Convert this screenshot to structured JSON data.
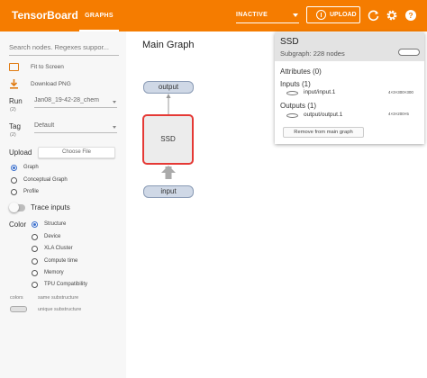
{
  "header": {
    "brand": "TensorBoard",
    "tab": "GRAPHS",
    "run_status": "INACTIVE",
    "upload_label": "UPLOAD",
    "accent_color": "#f57c00"
  },
  "sidebar": {
    "search_placeholder": "Search nodes. Regexes suppor...",
    "fit_to_screen": "Fit to Screen",
    "download_png": "Download PNG",
    "run_label": "Run",
    "run_count": "(2)",
    "run_value": "Jan08_19-42-28_chem",
    "tag_label": "Tag",
    "tag_count": "(2)",
    "tag_value": "Default",
    "upload_label": "Upload",
    "choose_file": "Choose File",
    "graph_types": [
      {
        "label": "Graph",
        "selected": true
      },
      {
        "label": "Conceptual Graph",
        "selected": false
      },
      {
        "label": "Profile",
        "selected": false
      }
    ],
    "trace_inputs": "Trace inputs",
    "color_label": "Color",
    "color_options": [
      {
        "label": "Structure",
        "selected": true
      },
      {
        "label": "Device",
        "selected": false
      },
      {
        "label": "XLA Cluster",
        "selected": false
      },
      {
        "label": "Compute time",
        "selected": false
      },
      {
        "label": "Memory",
        "selected": false
      },
      {
        "label": "TPU Compatibility",
        "selected": false
      }
    ],
    "legend_colors": "colors",
    "legend_same": "same substructure",
    "legend_unique": "unique substructure"
  },
  "graph": {
    "title": "Main Graph",
    "node_output": "output",
    "node_ssd": "SSD",
    "node_input": "input"
  },
  "info_card": {
    "title": "SSD",
    "subtitle": "Subgraph: 228 nodes",
    "attributes": "Attributes (0)",
    "inputs": "Inputs (1)",
    "input_name": "input/input.1",
    "input_shape": "4×3×300×300",
    "outputs": "Outputs (1)",
    "output_name": "output/output.1",
    "output_shape": "4×3×200×5",
    "remove_button": "Remove from main graph"
  }
}
